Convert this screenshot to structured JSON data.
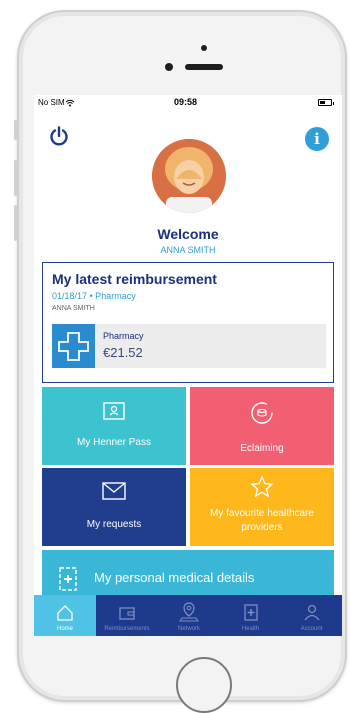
{
  "status_bar": {
    "carrier": "No SIM",
    "wifi_icon": "wifi-icon",
    "time": "09:58"
  },
  "header": {
    "info_label": "i",
    "power_icon": "power-icon"
  },
  "welcome": {
    "greeting": "Welcome",
    "name": "ANNA SMITH"
  },
  "reimbursement": {
    "title": "My latest reimbursement",
    "date_line": "01/18/17 • Pharmacy",
    "beneficiary": "ANNA SMITH",
    "item_label": "Pharmacy",
    "item_amount": "€21.52"
  },
  "tiles": [
    {
      "label": "My Henner Pass",
      "icon": "id-card-icon",
      "color": "#3cc3cf"
    },
    {
      "label": "Eclaiming",
      "icon": "eclaim-icon",
      "color": "#f25f73"
    },
    {
      "label": "My requests",
      "icon": "envelope-icon",
      "color": "#203d8e"
    },
    {
      "label": "My favourite healthcare providers",
      "icon": "star-icon",
      "color": "#ffb81c"
    }
  ],
  "medical": {
    "label": "My personal medical details",
    "icon": "medical-file-icon"
  },
  "tabbar": {
    "items": [
      {
        "label": "Home",
        "icon": "home-icon",
        "active": true
      },
      {
        "label": "Reimbursements",
        "icon": "wallet-icon",
        "active": false
      },
      {
        "label": "Network",
        "icon": "map-pin-icon",
        "active": false
      },
      {
        "label": "Health",
        "icon": "health-icon",
        "active": false
      },
      {
        "label": "Account",
        "icon": "user-icon",
        "active": false
      }
    ]
  }
}
